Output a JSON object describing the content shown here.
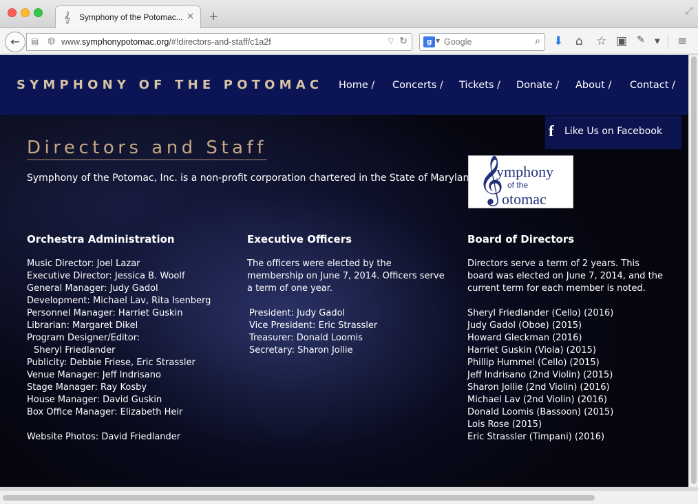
{
  "browser": {
    "tab_title": "Symphony of the Potomac...",
    "url_prefix": "www.",
    "url_domain": "symphonypotomac.org",
    "url_path": "/#!directors-and-staff/c1a2f",
    "search_placeholder": "Google",
    "search_engine_letter": "g"
  },
  "site": {
    "title": "SYMPHONY OF THE POTOMAC",
    "nav": [
      "Home /",
      "Concerts /",
      "Tickets /",
      "Donate /",
      "About /",
      "Contact /"
    ],
    "facebook_label": "Like Us on Facebook"
  },
  "page": {
    "heading": "Directors and Staff",
    "intro": "Symphony of the Potomac, Inc. is a non-profit corporation chartered in the State of Maryland.",
    "logo_text": {
      "line1": "ymphony",
      "line2": "of the",
      "line3": "otomac"
    }
  },
  "orchestra_admin": {
    "title": "Orchestra Administration",
    "lines": [
      "Music Director:  Joel Lazar",
      "Executive Director:  Jessica B. Woolf",
      "General Manager:  Judy Gadol",
      "Development:  Michael Lav, Rita Isenberg",
      "Personnel Manager:  Harriet Guskin",
      "Librarian:  Margaret Dikel",
      "Program Designer/Editor:",
      "Sheryl Friedlander",
      "Publicity:  Debbie Friese, Eric Strassler",
      "Venue Manager:  Jeff Indrisano",
      "Stage Manager:  Ray Kosby",
      "House Manager:  David Guskin",
      "Box Office Manager:  Elizabeth Heir"
    ],
    "photos": "Website Photos: David Friedlander"
  },
  "executive_officers": {
    "title": "Executive Officers",
    "intro": [
      "The officers were elected by the",
      "membership on June 7, 2014. Officers serve",
      "a term of one year."
    ],
    "officers": [
      "President:  Judy Gadol",
      "Vice President:  Eric Strassler",
      "Treasurer:  Donald Loomis",
      "Secretary:  Sharon Jollie"
    ]
  },
  "board": {
    "title": "Board of Directors",
    "intro": [
      "Directors serve a term of 2 years. This",
      "board was elected on June 7, 2014, and the",
      "current term for each member is noted."
    ],
    "members": [
      "Sheryl Friedlander  (Cello) (2016)",
      "Judy Gadol  (Oboe) (2015)",
      "Howard Gleckman  (2016)",
      "Harriet Guskin  (Viola) (2015)",
      "Phillip Hummel  (Cello) (2015)",
      "Jeff Indrisano  (2nd Violin) (2015)",
      "Sharon Jollie  (2nd Violin) (2016)",
      "Michael Lav  (2nd Violin) (2016)",
      "Donald Loomis  (Bassoon) (2015)",
      "Lois Rose  (2015)",
      "Eric Strassler  (Timpani) (2016)"
    ]
  },
  "colors": {
    "header_bg": "#0b1455",
    "title_gold": "#d6c4a4",
    "heading_gold": "#c8a784"
  }
}
